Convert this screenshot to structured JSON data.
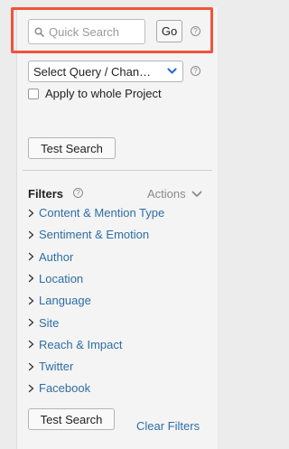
{
  "search": {
    "placeholder": "Quick Search",
    "go_label": "Go",
    "help_glyph": "?"
  },
  "query": {
    "selected": "Select Query / Chan…",
    "help_glyph": "?",
    "apply_label": "Apply to whole Project",
    "apply_checked": false,
    "test_label": "Test Search"
  },
  "filters": {
    "title": "Filters",
    "help_glyph": "?",
    "actions_label": "Actions",
    "items": [
      {
        "label": "Content & Mention Type"
      },
      {
        "label": "Sentiment & Emotion"
      },
      {
        "label": "Author"
      },
      {
        "label": "Location"
      },
      {
        "label": "Language"
      },
      {
        "label": "Site"
      },
      {
        "label": "Reach & Impact"
      },
      {
        "label": "Twitter"
      },
      {
        "label": "Facebook"
      }
    ],
    "test_label": "Test Search",
    "clear_label": "Clear Filters"
  },
  "colors": {
    "highlight": "#f1533b",
    "link": "#2e6ea6",
    "chevron_accent": "#2f6fd6"
  },
  "icons": {
    "search": "search-icon",
    "help": "help-circle-icon",
    "chevron": "chevron-down-icon",
    "arrow": "chevron-right-icon"
  }
}
